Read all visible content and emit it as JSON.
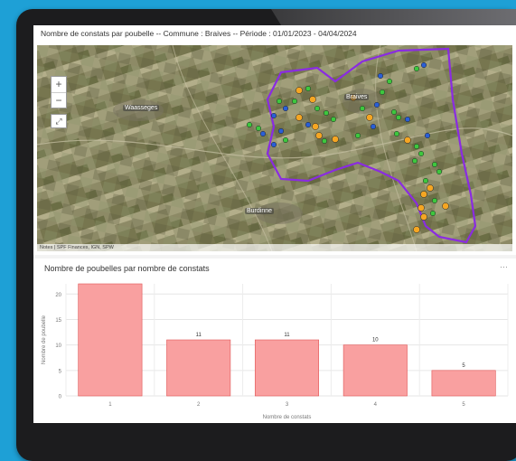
{
  "map": {
    "title": "Nombre de constats par poubelle -- Commune : Braives -- Période : 01/01/2023 - 04/04/2024",
    "zoom_in_label": "+",
    "zoom_out_label": "−",
    "home_label": "⤢",
    "places": [
      {
        "name": "Waasseges"
      },
      {
        "name": "Braives"
      },
      {
        "name": "Burdinne"
      }
    ],
    "attribution": "Notes | SPF Finances, IGN, SPW",
    "marker_colors": {
      "orange": "#f5a623",
      "green": "#3ec73e",
      "blue": "#2a5fd6"
    },
    "boundary_color": "#8a2be2"
  },
  "chart": {
    "title": "Nombre de poubelles par nombre de constats",
    "menu_label": "···"
  },
  "chart_data": {
    "type": "bar",
    "categories": [
      "1",
      "2",
      "3",
      "4",
      "5"
    ],
    "values": [
      22,
      11,
      11,
      10,
      5
    ],
    "data_labels": [
      "",
      "11",
      "11",
      "10",
      "5"
    ],
    "xlabel": "Nombre de constats",
    "ylabel": "Nombre de poubelle",
    "ylim": [
      0,
      22
    ],
    "yticks": [
      "0",
      "5",
      "10",
      "15",
      "20"
    ],
    "grid": true,
    "bar_color": "#f9a0a0",
    "bar_stroke": "#e05555"
  }
}
